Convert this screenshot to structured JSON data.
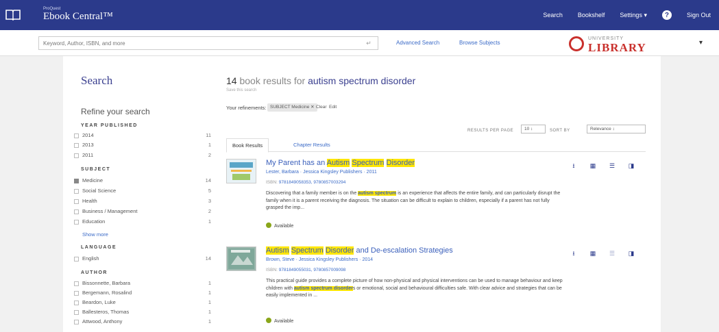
{
  "brand": {
    "small": "ProQuest",
    "main": "Ebook Central™"
  },
  "topnav": {
    "search": "Search",
    "bookshelf": "Bookshelf",
    "settings": "Settings ▾",
    "help_icon": "?",
    "signout": "Sign Out"
  },
  "searchbar": {
    "placeholder": "Keyword, Author, ISBN, and more",
    "go_icon": "↵",
    "advanced": "Advanced Search",
    "browse": "Browse Subjects"
  },
  "library": {
    "small": "UNIVERSITY",
    "big": "LIBRARY"
  },
  "user_caret": "▾",
  "sidebar": {
    "title": "Search",
    "refine": "Refine your search",
    "year": {
      "heading": "YEAR PUBLISHED",
      "items": [
        {
          "label": "2014",
          "count": "11",
          "checked": false
        },
        {
          "label": "2013",
          "count": "1",
          "checked": false
        },
        {
          "label": "2011",
          "count": "2",
          "checked": false
        }
      ]
    },
    "subject": {
      "heading": "SUBJECT",
      "items": [
        {
          "label": "Medicine",
          "count": "14",
          "checked": true
        },
        {
          "label": "Social Science",
          "count": "5",
          "checked": false
        },
        {
          "label": "Health",
          "count": "3",
          "checked": false
        },
        {
          "label": "Business / Management",
          "count": "2",
          "checked": false
        },
        {
          "label": "Education",
          "count": "1",
          "checked": false
        }
      ],
      "show_more": "Show more"
    },
    "language": {
      "heading": "LANGUAGE",
      "items": [
        {
          "label": "English",
          "count": "14",
          "checked": false
        }
      ]
    },
    "author": {
      "heading": "AUTHOR",
      "items": [
        {
          "label": "Bissonnette, Barbara",
          "count": "1",
          "checked": false
        },
        {
          "label": "Bergemann, Rosalind",
          "count": "1",
          "checked": false
        },
        {
          "label": "Beardon, Luke",
          "count": "1",
          "checked": false
        },
        {
          "label": "Ballesteros, Thomas",
          "count": "1",
          "checked": false
        },
        {
          "label": "Attwood, Anthony",
          "count": "1",
          "checked": false
        }
      ]
    }
  },
  "results": {
    "count": "14",
    "mid": " book results for ",
    "query": "autism spectrum disorder",
    "save_search": "Save this search",
    "refinements_label": "Your refinements:",
    "chip": "SUBJECT Medicine  ✕",
    "clear": "Clear",
    "edit": "Edit",
    "rpp_label": "RESULTS PER PAGE",
    "rpp_value": "10  ↕",
    "sort_label": "SORT BY",
    "sort_value": "Relevance          ↕",
    "tab_books": "Book Results",
    "tab_chapters": "Chapter Results",
    "items": [
      {
        "title_pre": "My Parent has an ",
        "title_hl1": "Autism",
        "title_sp1": " ",
        "title_hl2": "Spectrum",
        "title_sp2": " ",
        "title_hl3": "Disorder",
        "title_post": "",
        "meta": "Lester, Barbara · Jessica Kingsley Publishers · 2011",
        "isbn_label": "ISBN:",
        "isbn": " 9781849058353, 9780857003294",
        "desc_pre": "Discovering that a family member is on the ",
        "desc_hl": "autism spectrum",
        "desc_post": " is an experience that affects the entire family, and can particularly disrupt the family when it is a parent receiving the diagnosis. The situation can be difficult to explain to children, especially if a parent has not fully grasped the imp...",
        "avail": "Available",
        "cover_color": "#5aa6c8"
      },
      {
        "title_pre": "",
        "title_hl1": "Autism",
        "title_sp1": " ",
        "title_hl2": "Spectrum",
        "title_sp2": " ",
        "title_hl3": "Disorder",
        "title_post": " and De-escalation Strategies",
        "meta": "Brown, Steve · Jessica Kingsley Publishers · 2014",
        "isbn_label": "ISBN:",
        "isbn": " 9781849055031, 9780857009098",
        "desc_pre": "This practical guide provides a complete picture of how non-physical and physical interventions can be used to manage behaviour and keep children with ",
        "desc_hl": "autism spectrum disorder",
        "desc_post": "s or emotional, social and behavioural difficulties safe. With clear advice and strategies that can be easily implemented in ...",
        "avail": "Available",
        "cover_color": "#7fa89a"
      }
    ],
    "actions": {
      "download": "⭳",
      "read": "▦",
      "list": "☰",
      "cite": "◨"
    }
  }
}
